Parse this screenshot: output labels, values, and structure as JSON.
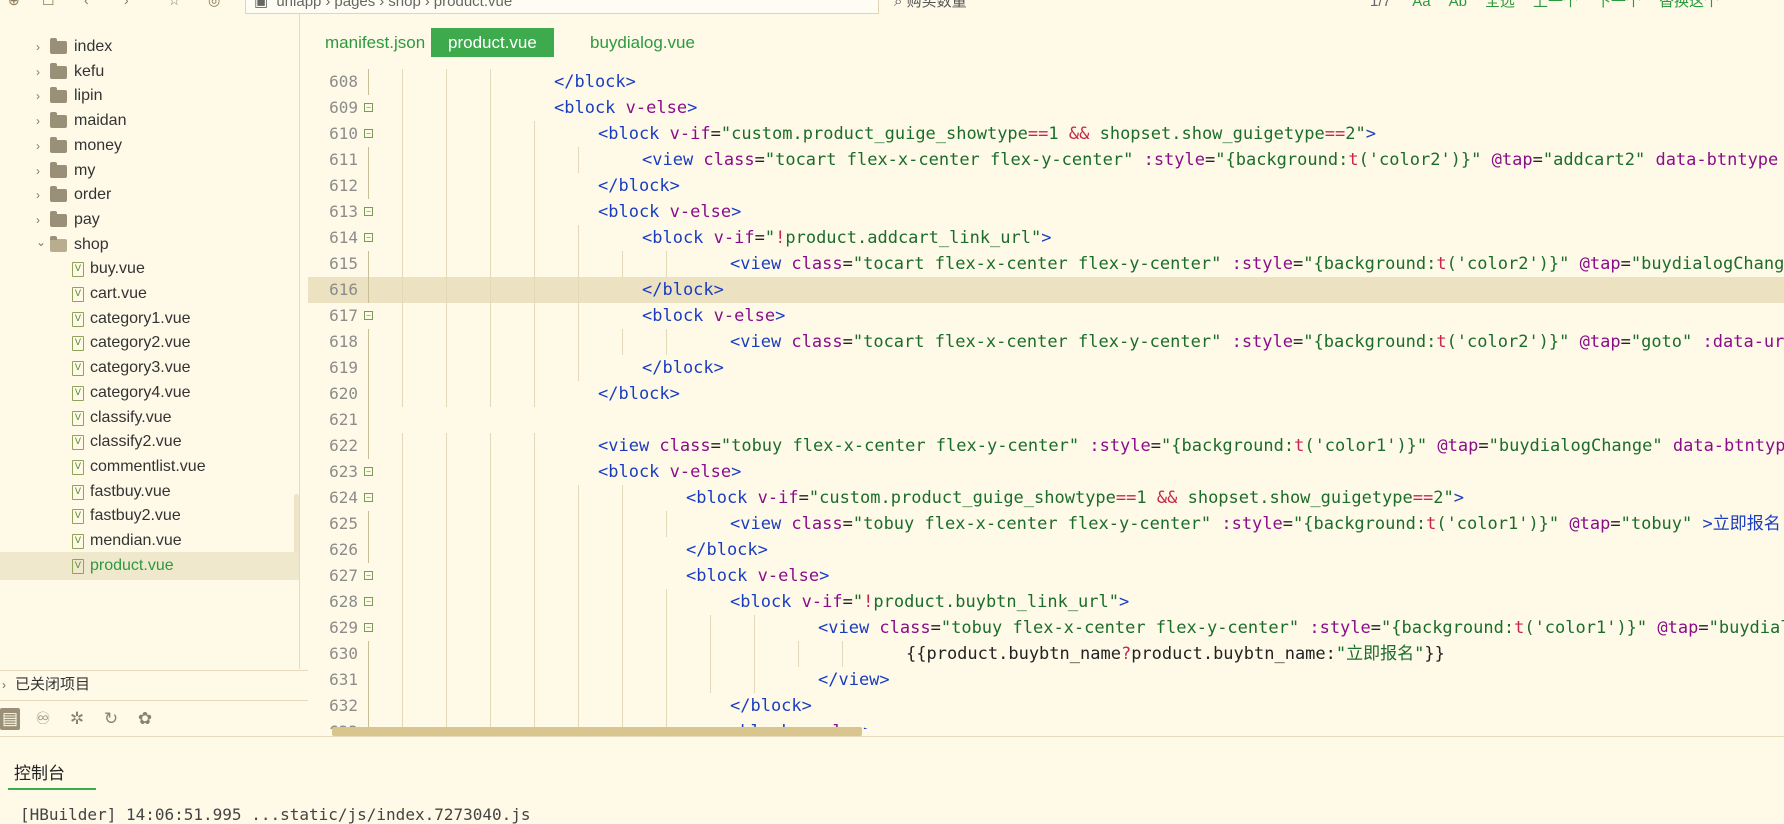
{
  "toolbar": {
    "breadcrumb": [
      "unlapp",
      "pages",
      "shop",
      "product.vue"
    ],
    "search_text": "购买数量",
    "match_count": "1/7",
    "actions": [
      "Aa",
      "Ab",
      "全选",
      "上一个",
      "下一个",
      "替换这个"
    ]
  },
  "sidebar": {
    "items": [
      {
        "label": "index",
        "kind": "folder",
        "expanded": false,
        "depth": 0
      },
      {
        "label": "kefu",
        "kind": "folder",
        "expanded": false,
        "depth": 0
      },
      {
        "label": "lipin",
        "kind": "folder",
        "expanded": false,
        "depth": 0
      },
      {
        "label": "maidan",
        "kind": "folder",
        "expanded": false,
        "depth": 0
      },
      {
        "label": "money",
        "kind": "folder",
        "expanded": false,
        "depth": 0
      },
      {
        "label": "my",
        "kind": "folder",
        "expanded": false,
        "depth": 0
      },
      {
        "label": "order",
        "kind": "folder",
        "expanded": false,
        "depth": 0
      },
      {
        "label": "pay",
        "kind": "folder",
        "expanded": false,
        "depth": 0
      },
      {
        "label": "shop",
        "kind": "folder",
        "expanded": true,
        "depth": 0
      },
      {
        "label": "buy.vue",
        "kind": "file",
        "depth": 1
      },
      {
        "label": "cart.vue",
        "kind": "file",
        "depth": 1
      },
      {
        "label": "category1.vue",
        "kind": "file",
        "depth": 1
      },
      {
        "label": "category2.vue",
        "kind": "file",
        "depth": 1
      },
      {
        "label": "category3.vue",
        "kind": "file",
        "depth": 1
      },
      {
        "label": "category4.vue",
        "kind": "file",
        "depth": 1
      },
      {
        "label": "classify.vue",
        "kind": "file",
        "depth": 1
      },
      {
        "label": "classify2.vue",
        "kind": "file",
        "depth": 1
      },
      {
        "label": "commentlist.vue",
        "kind": "file",
        "depth": 1
      },
      {
        "label": "fastbuy.vue",
        "kind": "file",
        "depth": 1
      },
      {
        "label": "fastbuy2.vue",
        "kind": "file",
        "depth": 1
      },
      {
        "label": "mendian.vue",
        "kind": "file",
        "depth": 1
      },
      {
        "label": "product.vue",
        "kind": "file",
        "depth": 1,
        "selected": true
      }
    ],
    "closed_projects_label": "已关闭项目"
  },
  "tabs": [
    {
      "label": "manifest.json",
      "active": false
    },
    {
      "label": "product.vue",
      "active": true
    },
    {
      "label": "buydialog.vue",
      "active": false
    }
  ],
  "code_lines": [
    {
      "num": "608",
      "fold": "",
      "indent": 4,
      "tokens": [
        [
          "t",
          "</block>"
        ]
      ]
    },
    {
      "num": "609",
      "fold": "-",
      "indent": 4,
      "tokens": [
        [
          "t",
          "<block "
        ],
        [
          "a",
          "v-else"
        ],
        [
          "t",
          ">"
        ]
      ]
    },
    {
      "num": "610",
      "fold": "-",
      "indent": 5,
      "tokens": [
        [
          "t",
          "<block "
        ],
        [
          "a",
          "v-if"
        ],
        [
          "p",
          "="
        ],
        [
          "s",
          "\"custom.product_guige_showtype"
        ],
        [
          "o",
          "=="
        ],
        [
          "s",
          "1 "
        ],
        [
          "o",
          "&&"
        ],
        [
          "s",
          " shopset.show_guigetype"
        ],
        [
          "o",
          "=="
        ],
        [
          "s",
          "2\""
        ],
        [
          "t",
          ">"
        ]
      ]
    },
    {
      "num": "611",
      "fold": "",
      "indent": 6,
      "tokens": [
        [
          "t",
          "<view "
        ],
        [
          "a",
          "class"
        ],
        [
          "p",
          "="
        ],
        [
          "s",
          "\"tocart flex-x-center flex-y-center\""
        ],
        [
          "p",
          " "
        ],
        [
          "a",
          ":style"
        ],
        [
          "p",
          "="
        ],
        [
          "s",
          "\"{background:"
        ],
        [
          "o",
          "t"
        ],
        [
          "s",
          "('color2')}\""
        ],
        [
          "p",
          " "
        ],
        [
          "a",
          "@tap"
        ],
        [
          "p",
          "="
        ],
        [
          "s",
          "\"addcart2\""
        ],
        [
          "p",
          " "
        ],
        [
          "a",
          "data-btntype"
        ]
      ]
    },
    {
      "num": "612",
      "fold": "",
      "indent": 5,
      "tokens": [
        [
          "t",
          "</block>"
        ]
      ]
    },
    {
      "num": "613",
      "fold": "-",
      "indent": 5,
      "tokens": [
        [
          "t",
          "<block "
        ],
        [
          "a",
          "v-else"
        ],
        [
          "t",
          ">"
        ]
      ]
    },
    {
      "num": "614",
      "fold": "-",
      "indent": 6,
      "tokens": [
        [
          "t",
          "<block "
        ],
        [
          "a",
          "v-if"
        ],
        [
          "p",
          "="
        ],
        [
          "s",
          "\""
        ],
        [
          "o",
          "!"
        ],
        [
          "s",
          "product.addcart_link_url\""
        ],
        [
          "t",
          ">"
        ]
      ]
    },
    {
      "num": "615",
      "fold": "",
      "indent": 8,
      "tokens": [
        [
          "t",
          "<view "
        ],
        [
          "a",
          "class"
        ],
        [
          "p",
          "="
        ],
        [
          "s",
          "\"tocart flex-x-center flex-y-center\""
        ],
        [
          "p",
          " "
        ],
        [
          "a",
          ":style"
        ],
        [
          "p",
          "="
        ],
        [
          "s",
          "\"{background:"
        ],
        [
          "o",
          "t"
        ],
        [
          "s",
          "('color2')}\""
        ],
        [
          "p",
          " "
        ],
        [
          "a",
          "@tap"
        ],
        [
          "p",
          "="
        ],
        [
          "s",
          "\"buydialogChange"
        ]
      ]
    },
    {
      "num": "616",
      "fold": "",
      "indent": 6,
      "current": true,
      "tokens": [
        [
          "t",
          "</block>"
        ]
      ]
    },
    {
      "num": "617",
      "fold": "-",
      "indent": 6,
      "tokens": [
        [
          "t",
          "<block "
        ],
        [
          "a",
          "v-else"
        ],
        [
          "t",
          ">"
        ]
      ]
    },
    {
      "num": "618",
      "fold": "",
      "indent": 8,
      "tokens": [
        [
          "t",
          "<view "
        ],
        [
          "a",
          "class"
        ],
        [
          "p",
          "="
        ],
        [
          "s",
          "\"tocart flex-x-center flex-y-center\""
        ],
        [
          "p",
          " "
        ],
        [
          "a",
          ":style"
        ],
        [
          "p",
          "="
        ],
        [
          "s",
          "\"{background:"
        ],
        [
          "o",
          "t"
        ],
        [
          "s",
          "('color2')}\""
        ],
        [
          "p",
          " "
        ],
        [
          "a",
          "@tap"
        ],
        [
          "p",
          "="
        ],
        [
          "s",
          "\"goto\""
        ],
        [
          "p",
          " "
        ],
        [
          "a",
          ":data-url"
        ]
      ]
    },
    {
      "num": "619",
      "fold": "",
      "indent": 6,
      "tokens": [
        [
          "t",
          "</block>"
        ]
      ]
    },
    {
      "num": "620",
      "fold": "",
      "indent": 5,
      "tokens": [
        [
          "t",
          "</block>"
        ]
      ]
    },
    {
      "num": "621",
      "fold": "",
      "indent": 0,
      "tokens": []
    },
    {
      "num": "622",
      "fold": "",
      "indent": 5,
      "tokens": [
        [
          "t",
          "<view "
        ],
        [
          "a",
          "class"
        ],
        [
          "p",
          "="
        ],
        [
          "s",
          "\"tobuy flex-x-center flex-y-center\""
        ],
        [
          "p",
          " "
        ],
        [
          "a",
          ":style"
        ],
        [
          "p",
          "="
        ],
        [
          "s",
          "\"{background:"
        ],
        [
          "o",
          "t"
        ],
        [
          "s",
          "('color1')}\""
        ],
        [
          "p",
          " "
        ],
        [
          "a",
          "@tap"
        ],
        [
          "p",
          "="
        ],
        [
          "s",
          "\"buydialogChange\""
        ],
        [
          "p",
          " "
        ],
        [
          "a",
          "data-btntype"
        ]
      ]
    },
    {
      "num": "623",
      "fold": "-",
      "indent": 5,
      "tokens": [
        [
          "t",
          "<block "
        ],
        [
          "a",
          "v-else"
        ],
        [
          "t",
          ">"
        ]
      ]
    },
    {
      "num": "624",
      "fold": "-",
      "indent": 7,
      "tokens": [
        [
          "t",
          "<block "
        ],
        [
          "a",
          "v-if"
        ],
        [
          "p",
          "="
        ],
        [
          "s",
          "\"custom.product_guige_showtype"
        ],
        [
          "o",
          "=="
        ],
        [
          "s",
          "1 "
        ],
        [
          "o",
          "&&"
        ],
        [
          "s",
          " shopset.show_guigetype"
        ],
        [
          "o",
          "=="
        ],
        [
          "s",
          "2\""
        ],
        [
          "t",
          ">"
        ]
      ]
    },
    {
      "num": "625",
      "fold": "",
      "indent": 8,
      "tokens": [
        [
          "t",
          "<view "
        ],
        [
          "a",
          "class"
        ],
        [
          "p",
          "="
        ],
        [
          "s",
          "\"tobuy flex-x-center flex-y-center\""
        ],
        [
          "p",
          " "
        ],
        [
          "a",
          ":style"
        ],
        [
          "p",
          "="
        ],
        [
          "s",
          "\"{background:"
        ],
        [
          "o",
          "t"
        ],
        [
          "s",
          "('color1')}\""
        ],
        [
          "p",
          " "
        ],
        [
          "a",
          "@tap"
        ],
        [
          "p",
          "="
        ],
        [
          "s",
          "\"tobuy\""
        ],
        [
          "p",
          " "
        ],
        [
          "t",
          ">"
        ],
        [
          "t",
          "立即报名"
        ]
      ]
    },
    {
      "num": "626",
      "fold": "",
      "indent": 7,
      "tokens": [
        [
          "t",
          "</block>"
        ]
      ]
    },
    {
      "num": "627",
      "fold": "-",
      "indent": 7,
      "tokens": [
        [
          "t",
          "<block "
        ],
        [
          "a",
          "v-else"
        ],
        [
          "t",
          ">"
        ]
      ]
    },
    {
      "num": "628",
      "fold": "-",
      "indent": 8,
      "tokens": [
        [
          "t",
          "<block "
        ],
        [
          "a",
          "v-if"
        ],
        [
          "p",
          "="
        ],
        [
          "s",
          "\""
        ],
        [
          "o",
          "!"
        ],
        [
          "s",
          "product.buybtn_link_url\""
        ],
        [
          "t",
          ">"
        ]
      ]
    },
    {
      "num": "629",
      "fold": "-",
      "indent": 10,
      "tokens": [
        [
          "t",
          "<view "
        ],
        [
          "a",
          "class"
        ],
        [
          "p",
          "="
        ],
        [
          "s",
          "\"tobuy flex-x-center flex-y-center\""
        ],
        [
          "p",
          " "
        ],
        [
          "a",
          ":style"
        ],
        [
          "p",
          "="
        ],
        [
          "s",
          "\"{background:"
        ],
        [
          "o",
          "t"
        ],
        [
          "s",
          "('color1')}\""
        ],
        [
          "p",
          " "
        ],
        [
          "a",
          "@tap"
        ],
        [
          "p",
          "="
        ],
        [
          "s",
          "\"buydialogChange"
        ]
      ]
    },
    {
      "num": "630",
      "fold": "",
      "indent": 12,
      "tokens": [
        [
          "p",
          "{{product.buybtn_name"
        ],
        [
          "o",
          "?"
        ],
        [
          "p",
          "product.buybtn_name:"
        ],
        [
          "s",
          "\"立即报名\""
        ],
        [
          "p",
          "}}"
        ]
      ]
    },
    {
      "num": "631",
      "fold": "",
      "indent": 10,
      "tokens": [
        [
          "t",
          "</view>"
        ]
      ]
    },
    {
      "num": "632",
      "fold": "",
      "indent": 8,
      "tokens": [
        [
          "t",
          "</block>"
        ]
      ]
    },
    {
      "num": "633",
      "fold": "",
      "indent": 8,
      "tokens": [
        [
          "t",
          "<block "
        ],
        [
          "a",
          "v-else"
        ],
        [
          "t",
          ">"
        ]
      ]
    }
  ],
  "console": {
    "tab_label": "控制台",
    "line": "[HBuilder] 14:06:51.995 ...static/js/index.7273040.js"
  }
}
